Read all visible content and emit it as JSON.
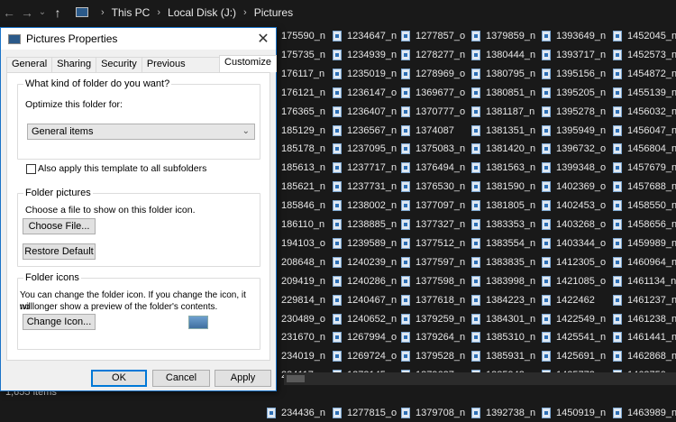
{
  "explorer": {
    "breadcrumb": [
      "This PC",
      "Local Disk (J:)",
      "Pictures"
    ],
    "status": "1,655 items",
    "columns": [
      [
        "175590_n",
        "175735_n",
        "176117_n",
        "176121_n",
        "176365_n",
        "185129_n",
        "185178_n",
        "185613_n",
        "185621_n",
        "185846_n",
        "186110_n",
        "194103_o",
        "208648_n",
        "209419_n",
        "229814_n",
        "230489_o",
        "231670_n",
        "234019_n",
        "234117_n",
        "234335_n",
        "234436_n"
      ],
      [
        "1234647_n",
        "1234939_n",
        "1235019_n",
        "1236147_o",
        "1236407_n",
        "1236567_n",
        "1237095_n",
        "1237717_n",
        "1237731_n",
        "1238002_n",
        "1238885_n",
        "1239589_n",
        "1240239_n",
        "1240286_n",
        "1240467_n",
        "1240652_n",
        "1267994_o",
        "1269724_o",
        "1273145_o",
        "1276832_o",
        "1277815_o"
      ],
      [
        "1277857_o",
        "1278277_n",
        "1278969_o",
        "1369677_o",
        "1370777_o",
        "1374087",
        "1375083_n",
        "1376494_n",
        "1376530_n",
        "1377097_n",
        "1377327_n",
        "1377512_n",
        "1377597_n",
        "1377598_n",
        "1377618_n",
        "1379259_n",
        "1379264_n",
        "1379528_n",
        "1379627_n",
        "1379677_n",
        "1379708_n"
      ],
      [
        "1379859_n",
        "1380444_n",
        "1380795_n",
        "1380851_n",
        "1381187_n",
        "1381351_n",
        "1381420_n",
        "1381563_n",
        "1381590_n",
        "1381805_n",
        "1383353_n",
        "1383554_n",
        "1383835_n",
        "1383998_n",
        "1384223_n",
        "1384301_n",
        "1385310_n",
        "1385931_n",
        "1385943_n",
        "1390503_n",
        "1392738_n"
      ],
      [
        "1393649_n",
        "1393717_n",
        "1395156_n",
        "1395205_n",
        "1395278_n",
        "1395949_n",
        "1396732_o",
        "1399348_o",
        "1402369_o",
        "1402453_o",
        "1403268_o",
        "1403344_o",
        "1412305_o",
        "1421085_o",
        "1422462",
        "1422549_n",
        "1425541_n",
        "1425691_n",
        "1425773_n",
        "1441581_n",
        "1450919_n"
      ],
      [
        "1452045_n",
        "1452573_n",
        "1454872_n",
        "1455139_n",
        "1456032_n",
        "1456047_n",
        "1456804_n",
        "1457679_n",
        "1457688_n",
        "1458550_n",
        "1458656_n",
        "1459989_n",
        "1460964_n",
        "1461134_n",
        "1461237_n",
        "1461238_n",
        "1461441_n",
        "1462868_n",
        "1463750_n",
        "1463768_n",
        "1463989_n"
      ]
    ]
  },
  "dialog": {
    "title": "Pictures Properties",
    "tabs": [
      "General",
      "Sharing",
      "Security",
      "Previous Versions",
      "Customize"
    ],
    "selected_tab": "Customize",
    "kind_group": {
      "title": "What kind of folder do you want?",
      "optimize_label": "Optimize this folder for:",
      "optimize_value": "General items",
      "apply_subfolders_label": "Also apply this template to all subfolders",
      "apply_subfolders_checked": false
    },
    "pictures_group": {
      "title": "Folder pictures",
      "description": "Choose a file to show on this folder icon.",
      "choose_file": "Choose File...",
      "restore_default": "Restore Default"
    },
    "icons_group": {
      "title": "Folder icons",
      "description_line1": "You can change the folder icon. If you change the icon, it will",
      "description_line2": "no longer show a preview of the folder's contents.",
      "change_icon": "Change Icon..."
    },
    "buttons": {
      "ok": "OK",
      "cancel": "Cancel",
      "apply": "Apply"
    }
  },
  "colors": {
    "explorer_bg": "#191919",
    "dialog_bg": "#f0f0f0",
    "accent": "#0078d7"
  }
}
